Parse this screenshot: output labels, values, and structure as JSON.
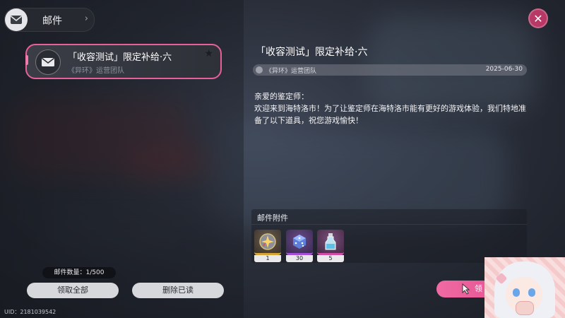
{
  "header": {
    "title": "邮件",
    "icon": "mail-icon"
  },
  "mail_list": [
    {
      "title": "「收容测试」限定补给·六",
      "sender": "《异环》运营团队",
      "selected": true,
      "starred": false
    }
  ],
  "footer": {
    "count": "邮件数量：1/500",
    "claim_all": "领取全部",
    "delete_read": "删除已读",
    "uid": "UID：2181039542"
  },
  "detail": {
    "title": "「收容测试」限定补给·六",
    "sender": "《异环》运营团队",
    "date": "2025-06-30",
    "greeting": "亲爱的鉴定师：",
    "body": "欢迎来到海特洛市！为了让鉴定师在海特洛市能有更好的游戏体验，我们特地准备了以下道具，祝您游戏愉快！",
    "attachments_label": "邮件附件",
    "attachments": [
      {
        "icon": "orb-icon",
        "qty": "1",
        "rarity_color": "#d6a434"
      },
      {
        "icon": "dice-icon",
        "qty": "30",
        "rarity_color": "#a54fd6"
      },
      {
        "icon": "bottle-icon",
        "qty": "5",
        "rarity_color": "#d04ca4"
      }
    ],
    "collect_label": "领"
  },
  "colors": {
    "accent": "#e8609a",
    "button_grey": "#d7d8dc"
  }
}
